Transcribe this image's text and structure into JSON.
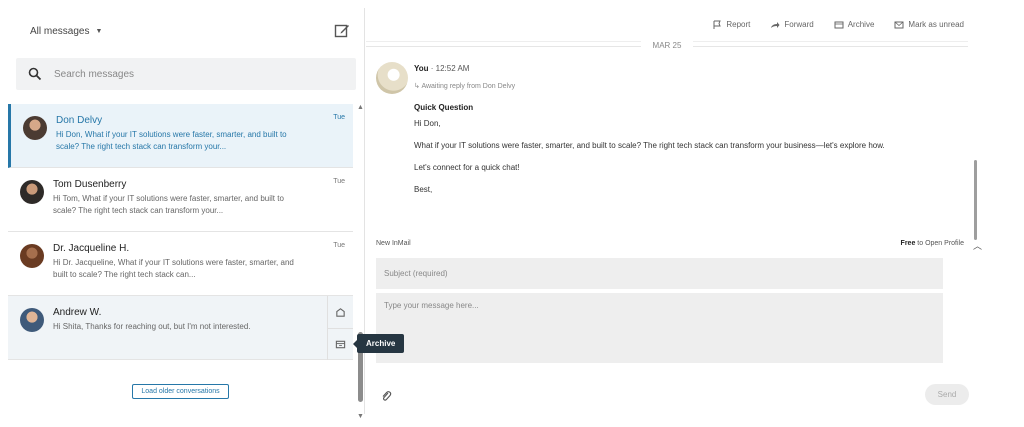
{
  "sidebar": {
    "filter_label": "All messages",
    "search_placeholder": "Search messages",
    "conversations": [
      {
        "name": "Don Delvy",
        "date": "Tue",
        "preview": "Hi Don, What if your IT solutions were faster, smarter, and built to scale? The right tech stack can transform your..."
      },
      {
        "name": "Tom Dusenberry",
        "date": "Tue",
        "preview": "Hi Tom, What if your IT solutions were faster, smarter, and built to scale? The right tech stack can transform your..."
      },
      {
        "name": "Dr. Jacqueline H.",
        "date": "Tue",
        "preview": "Hi Dr. Jacqueline, What if your IT solutions were faster, smarter, and built to scale? The right tech stack can..."
      },
      {
        "name": "Andrew W.",
        "date": "",
        "preview": "Hi Shita, Thanks for reaching out, but I'm not interested."
      }
    ],
    "tooltip": "Archive",
    "load_older": "Load older conversations"
  },
  "toolbar": {
    "report": "Report",
    "forward": "Forward",
    "archive": "Archive",
    "mark_unread": "Mark as unread"
  },
  "thread": {
    "date": "MAR 25",
    "sender": "You",
    "time": "· 12:52 AM",
    "status": "Awaiting reply from Don Delvy",
    "subject": "Quick Question",
    "greeting": "Hi Don,",
    "body": "What if your IT solutions were faster, smarter, and built to scale? The right tech stack can transform your business—let's explore how.",
    "cta": "Let's connect for a quick chat!",
    "signoff": "Best,"
  },
  "composer": {
    "label": "New InMail",
    "free": "Free",
    "open_profile": "to Open Profile",
    "subject_placeholder": "Subject (required)",
    "body_placeholder": "Type your message here...",
    "send": "Send"
  },
  "colors": {
    "accent": "#2677a8",
    "active_bg": "#eaf3f9",
    "tooltip_bg": "#263642"
  }
}
